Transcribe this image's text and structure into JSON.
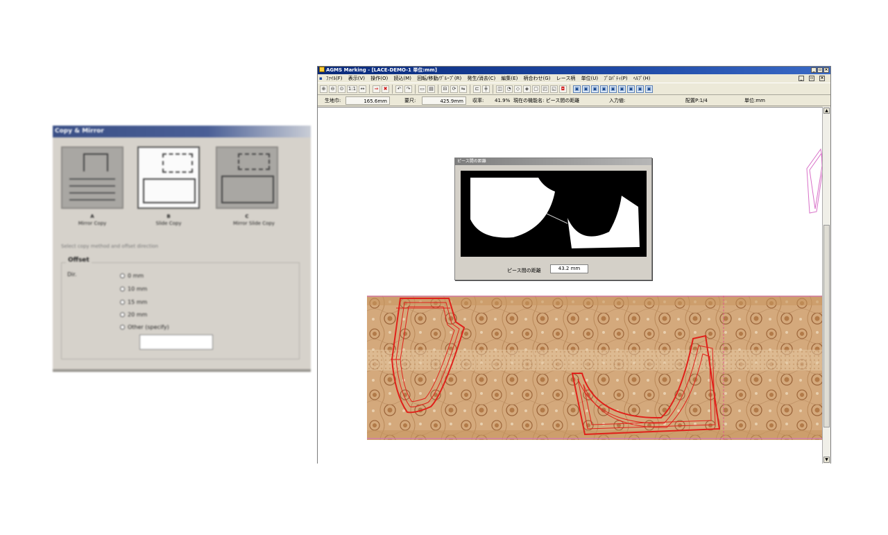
{
  "left_dialog": {
    "title": "Copy & Mirror",
    "options": [
      {
        "cap": "A",
        "sub": "Mirror Copy"
      },
      {
        "cap": "B",
        "sub": "Slide Copy"
      },
      {
        "cap": "C",
        "sub": "Mirror Slide Copy"
      }
    ],
    "note": "Select copy method and offset direction",
    "group_title": "Offset",
    "group_label": "Dir.",
    "radios": [
      "0 mm",
      "10 mm",
      "15 mm",
      "20 mm",
      "Other (specify)"
    ]
  },
  "window": {
    "title": "AGMS Marking - [LACE-DEMO-1  単位:mm]",
    "menu": [
      "ﾌｧｲﾙ(F)",
      "表示(V)",
      "操作(O)",
      "読込(M)",
      "回転/移動/ｸﾞﾙｰﾌﾟ(R)",
      "発生/消去(C)",
      "編集(E)",
      "柄合わせ(G)",
      "レース柄",
      "単位(U)",
      "ﾌﾟﾛﾊﾟﾃｨ(P)",
      "ﾍﾙﾌﾟ(H)"
    ],
    "toolbar_zoom_label": "1:1"
  },
  "status": {
    "fabric_width_label": "生地巾:",
    "fabric_width_value": "165.6mm",
    "required_length_label": "要尺:",
    "required_length_value": "425.9mm",
    "yield_label": "収率:",
    "yield_value": "41.9%",
    "function_label": "現在の機能名: ピース間の距離",
    "input_label": "入力値:",
    "layout_label": "配置P:1/4",
    "unit_label": "単位:mm"
  },
  "sub_dialog": {
    "title": "ピース間の距離",
    "distance_label": "ピース間の距離",
    "distance_value": "43.2 mm"
  },
  "colors": {
    "titlebar": "#1f4aa6",
    "fabric": "#d6a77a",
    "cut_line": "#e0201a",
    "guide": "#d870c8"
  }
}
